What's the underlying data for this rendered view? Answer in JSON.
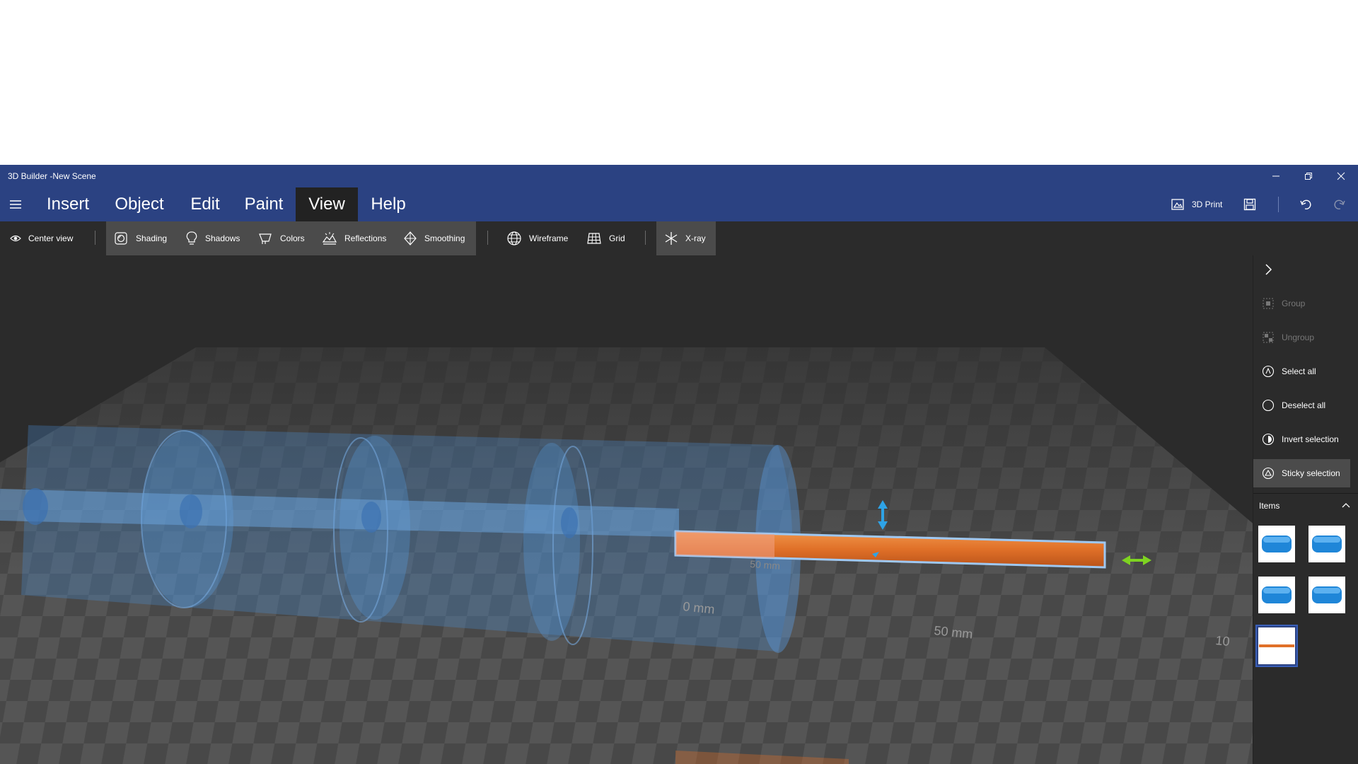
{
  "window": {
    "title": "3D Builder -New Scene",
    "controls": [
      "minimize-icon",
      "restore-icon",
      "close-icon"
    ]
  },
  "menu": {
    "items": [
      {
        "label": "Insert"
      },
      {
        "label": "Object"
      },
      {
        "label": "Edit"
      },
      {
        "label": "Paint"
      },
      {
        "label": "View",
        "active": true
      },
      {
        "label": "Help"
      }
    ],
    "print_label": "3D Print"
  },
  "ribbon": {
    "center_view": "Center view",
    "shading": "Shading",
    "shadows": "Shadows",
    "colors": "Colors",
    "reflections": "Reflections",
    "smoothing": "Smoothing",
    "wireframe": "Wireframe",
    "grid": "Grid",
    "xray": "X-ray"
  },
  "viewport": {
    "ruler_labels": [
      "50 mm",
      "0 mm",
      "10",
      "50 mm"
    ]
  },
  "panel": {
    "group": "Group",
    "ungroup": "Ungroup",
    "select_all": "Select all",
    "deselect_all": "Deselect all",
    "invert_selection": "Invert selection",
    "sticky_selection": "Sticky selection",
    "items_header": "Items"
  },
  "colors": {
    "titlebar": "#2b4282",
    "cylinder": "#4a9be8",
    "rod": "#e07028",
    "gizmo_vertical": "#2ea3e6",
    "gizmo_horizontal": "#7ed321"
  }
}
